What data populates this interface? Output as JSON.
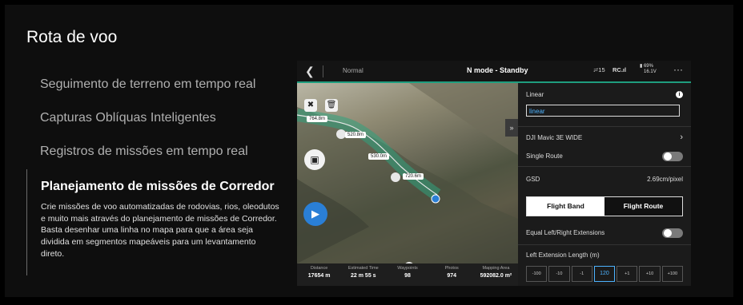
{
  "section": {
    "title": "Rota de voo",
    "features": [
      {
        "label": "Seguimento de terreno em tempo real"
      },
      {
        "label": "Capturas Oblíquas Inteligentes"
      },
      {
        "label": "Registros de missões em tempo real"
      },
      {
        "label": "Planejamento de missões de Corredor",
        "description": "Crie missões de voo automatizadas de rodovias, rios, oleodutos e muito mais através do planejamento de missões de Corredor. Basta desenhar uma linha no mapa para que a área seja dividida em segmentos mapeáveis para um levantamento direto."
      }
    ]
  },
  "app": {
    "topbar": {
      "back_icon": "chevron-left-icon",
      "mode": "Normal",
      "status": "N mode - Standby",
      "signal": "15",
      "rc": "RC",
      "battery_pct": "69%",
      "battery_v": "16.1V",
      "more_icon": "more-icon"
    },
    "map": {
      "distance_labels": [
        "764.8m",
        "520.8m",
        "530.0m",
        "720.6m"
      ]
    },
    "stats": [
      {
        "key": "Distance",
        "value": "17654 m"
      },
      {
        "key": "Estimated Time",
        "value": "22 m 55 s"
      },
      {
        "key": "Waypoints",
        "value": "98"
      },
      {
        "key": "Photos",
        "value": "974"
      },
      {
        "key": "Mapping Area",
        "value": "592082.0 m²"
      }
    ],
    "panel": {
      "route_type": "Linear",
      "name_value": "linear",
      "camera": "DJI Mavic 3E WIDE",
      "single_route": "Single Route",
      "gsd_label": "GSD",
      "gsd_value": "2.69cm/pixel",
      "seg_band": "Flight Band",
      "seg_route": "Flight Route",
      "equal_ext": "Equal Left/Right Extensions",
      "left_ext": "Left Extension Length (m)",
      "stepper": [
        "-100",
        "-10",
        "-1",
        "120",
        "+1",
        "+10",
        "+100"
      ]
    }
  }
}
